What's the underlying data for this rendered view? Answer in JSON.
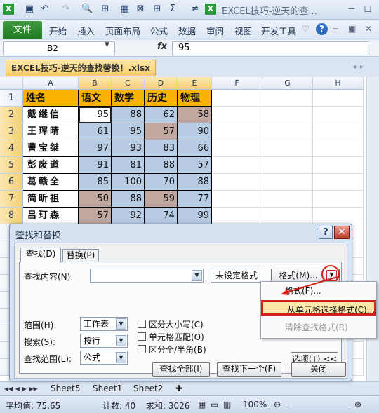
{
  "window": {
    "title": "EXCEL技巧-逆天的查..."
  },
  "ribbon": {
    "file": "文件",
    "tabs": [
      "开始",
      "插入",
      "页面布局",
      "公式",
      "数据",
      "审阅",
      "视图",
      "开发工具"
    ]
  },
  "formula_bar": {
    "name_box": "B2",
    "fx": "fx",
    "content": "95"
  },
  "workbook": {
    "tab_title": "EXCEL技巧-逆天的查找替换！.xlsx"
  },
  "sheet": {
    "columns": [
      "A",
      "B",
      "C",
      "D",
      "E",
      "F",
      "G",
      "H"
    ],
    "rows": [
      "1",
      "2",
      "3",
      "4",
      "5",
      "6",
      "7",
      "8"
    ],
    "headers": [
      "姓名",
      "语文",
      "数学",
      "历史",
      "物理"
    ],
    "data": [
      [
        "戴继信",
        "95",
        "88",
        "62",
        "58"
      ],
      [
        "王珲晴",
        "61",
        "95",
        "57",
        "90"
      ],
      [
        "曹宝桀",
        "97",
        "93",
        "83",
        "66"
      ],
      [
        "彭废道",
        "91",
        "81",
        "88",
        "57"
      ],
      [
        "葛赣全",
        "85",
        "100",
        "70",
        "88"
      ],
      [
        "简昕祖",
        "50",
        "88",
        "59",
        "77"
      ],
      [
        "吕玎森",
        "57",
        "92",
        "74",
        "99"
      ]
    ],
    "highlight": [
      [
        false,
        false,
        false,
        true
      ],
      [
        false,
        false,
        true,
        false
      ],
      [
        false,
        false,
        false,
        false
      ],
      [
        false,
        false,
        false,
        false
      ],
      [
        false,
        false,
        false,
        false
      ],
      [
        true,
        false,
        true,
        false
      ],
      [
        true,
        false,
        false,
        false
      ]
    ],
    "colors": {
      "header_fill": "#f9b403",
      "blue_fill": "#b8cce4",
      "brown_fill": "#c0a8a0"
    }
  },
  "dialog": {
    "title": "查找和替换",
    "tab_find": "查找(D)",
    "tab_replace": "替换(P)",
    "find_label": "查找内容(N):",
    "find_value": "",
    "no_format": "未设定格式",
    "format_btn": "格式(M)...",
    "scope_label": "范围(H):",
    "scope_value": "工作表",
    "search_label": "搜索(S):",
    "search_value": "按行",
    "lookin_label": "查找范围(L):",
    "lookin_value": "公式",
    "match_case": "区分大小写(C)",
    "match_cell": "单元格匹配(O)",
    "match_width": "区分全/半角(B)",
    "options_btn": "选项(T) <<",
    "find_all": "查找全部(I)",
    "find_next": "查找下一个(F)",
    "close": "关闭"
  },
  "format_menu": {
    "items": [
      "格式(F)...",
      "从单元格选择格式(C)...",
      "清除查找格式(R)"
    ]
  },
  "sheet_tabs": [
    "Sheet5",
    "Sheet1",
    "Sheet2"
  ],
  "status": {
    "average": "平均值: 75.65",
    "count": "计数: 40",
    "sum": "求和: 3026",
    "zoom": "100%"
  }
}
